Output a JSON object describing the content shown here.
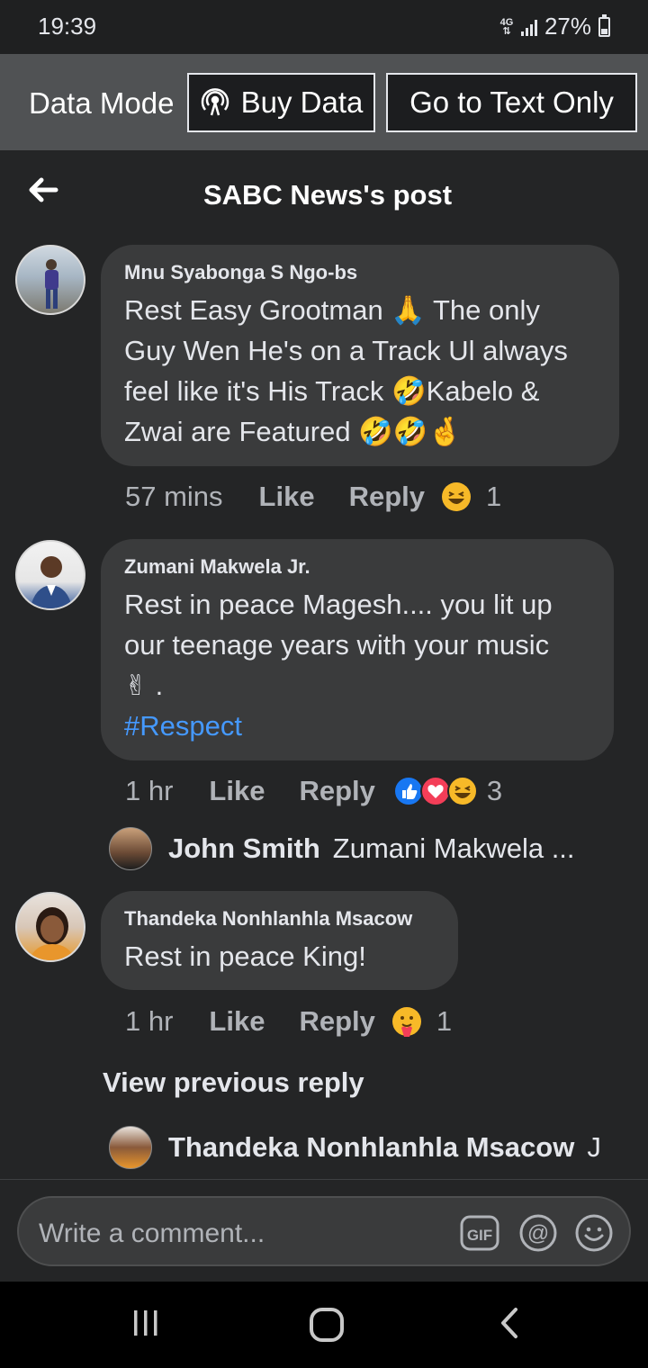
{
  "status_bar": {
    "time": "19:39",
    "network": "4G",
    "battery": "27%"
  },
  "data_mode": {
    "label": "Data Mode",
    "buy_data": "Buy Data",
    "text_only": "Go to Text Only"
  },
  "header": {
    "title": "SABC News's post"
  },
  "comments": [
    {
      "name": "Mnu Syabonga S Ngo-bs",
      "lines": [
        "Rest Easy Grootman 🙏 The only",
        "Guy Wen He's on a Track Ul always",
        "feel like it's His Track 🤣Kabelo &",
        "Zwai are Featured 🤣🤣🤞"
      ],
      "time": "57 mins",
      "like": "Like",
      "reply": "Reply",
      "reaction_count": "1"
    },
    {
      "name": "Zumani Makwela Jr.",
      "lines": [
        "Rest in peace Magesh.... you lit up",
        "our teenage years with your music",
        "✌ ."
      ],
      "hashtag": "#Respect",
      "time": "1 hr",
      "like": "Like",
      "reply": "Reply",
      "reaction_count": "3",
      "reply_preview": {
        "name": "John Smith",
        "text": "Zumani Makwela ..."
      }
    },
    {
      "name": "Thandeka Nonhlanhla Msacow",
      "lines": [
        "Rest in peace King!"
      ],
      "time": "1 hr",
      "like": "Like",
      "reply": "Reply",
      "reaction_count": "1",
      "view_previous": "View previous reply",
      "reply_preview": {
        "name": "Thandeka Nonhlanhla Msacow",
        "text": "J"
      }
    }
  ],
  "composer": {
    "placeholder": "Write a comment...",
    "gif_label": "GIF"
  },
  "colors": {
    "background": "#242526",
    "bubble": "#3a3b3c",
    "hashtag": "#4599ff",
    "like_blue": "#1877f2",
    "love_red": "#f33e58",
    "haha_yellow": "#f7b928"
  }
}
